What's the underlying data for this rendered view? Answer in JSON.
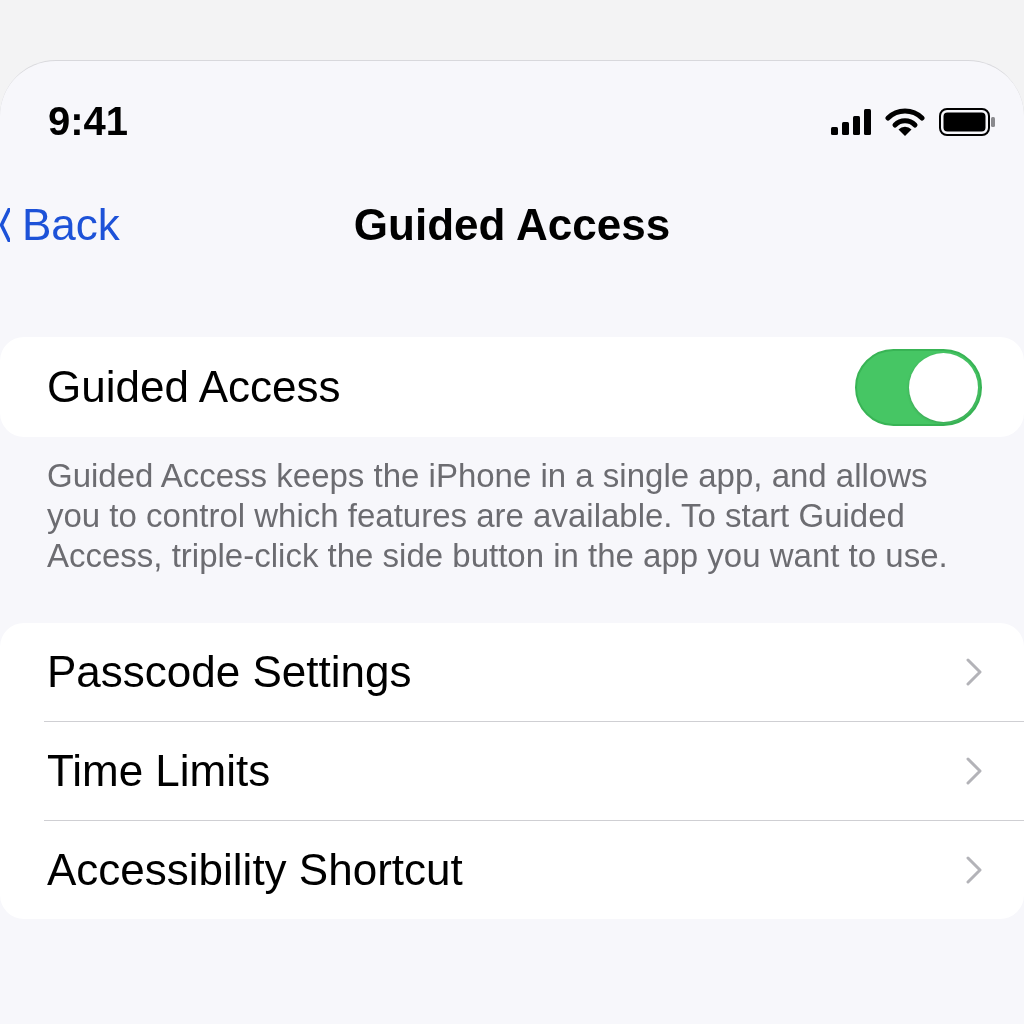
{
  "status_bar": {
    "time": "9:41"
  },
  "nav_bar": {
    "back_label": "Back",
    "title": "Guided Access"
  },
  "toggle_section": {
    "label": "Guided Access",
    "on": true,
    "footer": "Guided Access keeps the iPhone in a single app, and allows you to control which features are available. To start Guided Access, triple-click the side button in the app you want to use."
  },
  "menu": [
    {
      "label": "Passcode Settings"
    },
    {
      "label": "Time Limits"
    },
    {
      "label": "Accessibility Shortcut"
    }
  ]
}
